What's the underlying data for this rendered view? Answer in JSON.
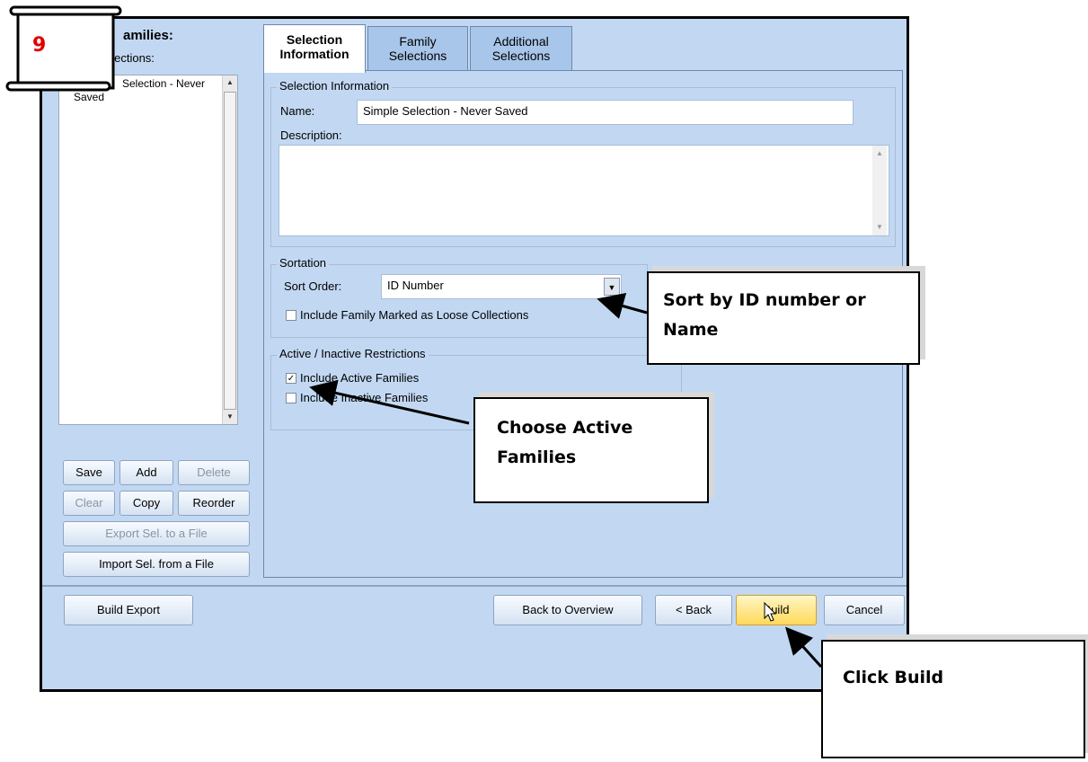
{
  "step_badge": {
    "number": "9"
  },
  "left_panel": {
    "heading": "amilies:",
    "subheading": "elections:",
    "selections": [
      {
        "label": "Selection - Never",
        "label_line2": "Saved"
      }
    ],
    "buttons": {
      "save": "Save",
      "add": "Add",
      "delete": "Delete",
      "clear": "Clear",
      "copy": "Copy",
      "reorder": "Reorder",
      "export": "Export Sel. to a File",
      "import": "Import  Sel. from a File"
    }
  },
  "tabs": [
    {
      "line1": "Selection",
      "line2": "Information",
      "active": true
    },
    {
      "line1": "Family",
      "line2": "Selections",
      "active": false
    },
    {
      "line1": "Additional",
      "line2": "Selections",
      "active": false
    }
  ],
  "selection_information": {
    "group_title": "Selection Information",
    "name_label": "Name:",
    "name_value": "Simple Selection - Never Saved",
    "description_label": "Description:",
    "description_value": ""
  },
  "sortation": {
    "group_title": "Sortation",
    "sort_order_label": "Sort Order:",
    "sort_order_value": "ID Number",
    "loose_collections_label": "Include Family Marked as Loose Collections",
    "loose_collections_checked": false
  },
  "active_inactive": {
    "group_title": "Active / Inactive Restrictions",
    "active_label": "Include Active Families",
    "active_checked": true,
    "inactive_label": "Include Inactive Families",
    "inactive_checked": false
  },
  "footer_buttons": {
    "build_export": "Build Export",
    "back_to_overview": "Back to Overview",
    "back": "< Back",
    "build": "Build",
    "cancel": "Cancel"
  },
  "callouts": {
    "sort": {
      "line1": "Sort by ID number or",
      "line2": "Name"
    },
    "active": {
      "line1": "Choose Active",
      "line2": "Families"
    },
    "build": {
      "line1": "Click Build"
    }
  },
  "colors": {
    "window_bg": "#c2d8f2",
    "badge_number": "#e00000",
    "build_button": "#ffe680"
  }
}
